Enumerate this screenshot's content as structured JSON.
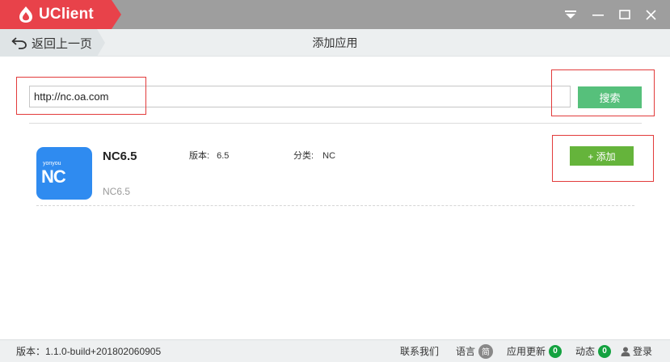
{
  "window": {
    "app_name": "UClient",
    "controls": [
      "dropdown-icon",
      "minimize-icon",
      "maximize-icon",
      "close-icon"
    ]
  },
  "navbar": {
    "back_label": "返回上一页",
    "title": "添加应用"
  },
  "search": {
    "value": "http://nc.oa.com",
    "button_label": "搜索"
  },
  "app": {
    "name": "NC6.5",
    "version_label": "版本:",
    "version_value": "6.5",
    "category_label": "分类:",
    "category_value": "NC",
    "subtitle": "NC6.5",
    "icon_brand": "yonyou",
    "icon_text": "NC",
    "add_label": "+ 添加"
  },
  "statusbar": {
    "version_text": "版本：1.1.0-build+201802060905",
    "contact": "联系我们",
    "language": "语言",
    "language_badge": "简",
    "updates": "应用更新",
    "updates_count": "0",
    "activity": "动态",
    "activity_count": "0",
    "login": "登录"
  },
  "colors": {
    "brand_red": "#e8424a",
    "titlebar_gray": "#9e9e9e",
    "search_green": "#56c07b",
    "add_green": "#65b43b",
    "app_icon_blue": "#2f8bf0",
    "highlight_red": "#e23b3b",
    "badge_green": "#14a240"
  }
}
